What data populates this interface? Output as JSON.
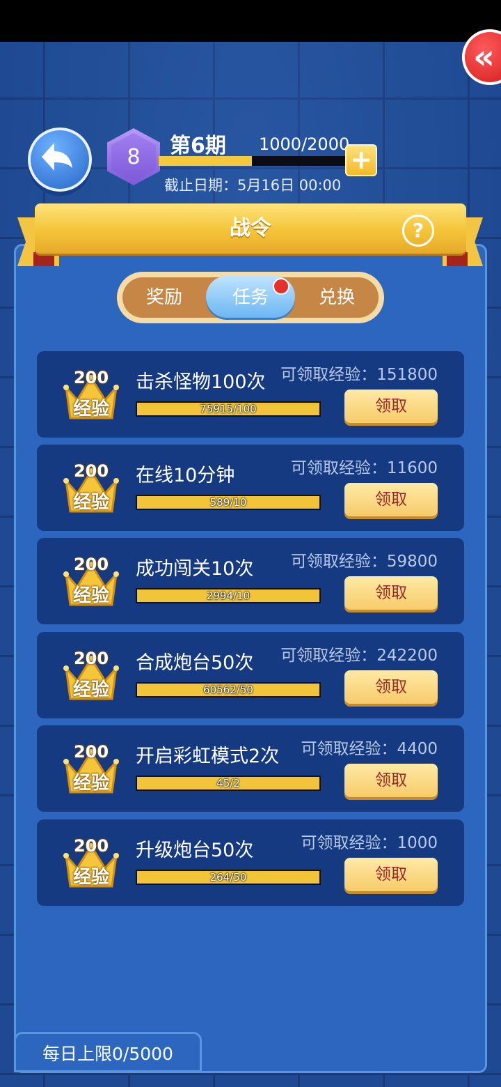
{
  "header": {
    "close_icon": "double-chevron-left-icon",
    "back_icon": "back-arrow-icon",
    "level": "8",
    "season_title": "第6期",
    "progress_text": "1000/2000",
    "progress_fraction": 0.5,
    "plus_label": "+",
    "deadline": "截止日期：5月16日 00:00"
  },
  "banner": {
    "title": "战令",
    "help_label": "?"
  },
  "tabs": [
    {
      "label": "奖励",
      "active": false
    },
    {
      "label": "任务",
      "active": true,
      "badge": true
    },
    {
      "label": "兑换",
      "active": false
    }
  ],
  "tasks": [
    {
      "reward_amount": "200",
      "reward_type": "经验",
      "name": "击杀怪物100次",
      "claimable": "可领取经验：151800",
      "progress": "75915/100",
      "button": "领取"
    },
    {
      "reward_amount": "200",
      "reward_type": "经验",
      "name": "在线10分钟",
      "claimable": "可领取经验：11600",
      "progress": "589/10",
      "button": "领取"
    },
    {
      "reward_amount": "200",
      "reward_type": "经验",
      "name": "成功闯关10次",
      "claimable": "可领取经验：59800",
      "progress": "2994/10",
      "button": "领取"
    },
    {
      "reward_amount": "200",
      "reward_type": "经验",
      "name": "合成炮台50次",
      "claimable": "可领取经验：242200",
      "progress": "60562/50",
      "button": "领取"
    },
    {
      "reward_amount": "200",
      "reward_type": "经验",
      "name": "开启彩虹模式2次",
      "claimable": "可领取经验：4400",
      "progress": "45/2",
      "button": "领取"
    },
    {
      "reward_amount": "200",
      "reward_type": "经验",
      "name": "升级炮台50次",
      "claimable": "可领取经验：1000",
      "progress": "264/50",
      "button": "领取"
    }
  ],
  "footer": {
    "daily_limit": "每日上限0/5000"
  },
  "colors": {
    "panel": "#2d66bf",
    "task_bg": "#153a82",
    "gold": "#f4c437",
    "button_text": "#a0262a"
  }
}
